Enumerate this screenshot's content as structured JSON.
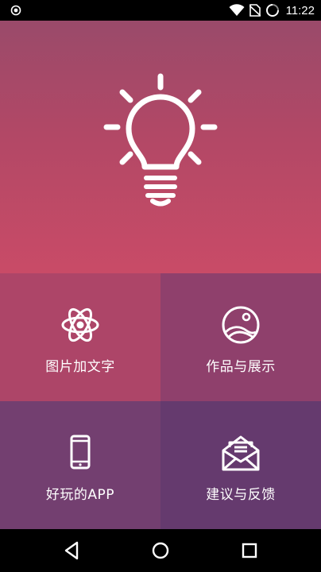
{
  "status_bar": {
    "time": "11:22",
    "icons": [
      "record-icon",
      "wifi-icon",
      "no-sim-icon",
      "battery-charging-icon"
    ]
  },
  "hero": {
    "icon": "lightbulb-icon"
  },
  "tiles": [
    {
      "label": "图片加文字",
      "icon": "atom-icon"
    },
    {
      "label": "作品与展示",
      "icon": "gallery-icon"
    },
    {
      "label": "好玩的APP",
      "icon": "phone-icon"
    },
    {
      "label": "建议与反馈",
      "icon": "envelope-icon"
    }
  ],
  "nav_bar": {
    "icons": [
      "back-icon",
      "home-icon",
      "recents-icon"
    ]
  },
  "colors": {
    "hero_top": "#9a4a6a",
    "hero_bottom": "#c94b67",
    "tile_top_left": "#ad4568",
    "tile_top_right": "#8f406c",
    "tile_bottom_left": "#733f70",
    "tile_bottom_right": "#653a6e"
  }
}
